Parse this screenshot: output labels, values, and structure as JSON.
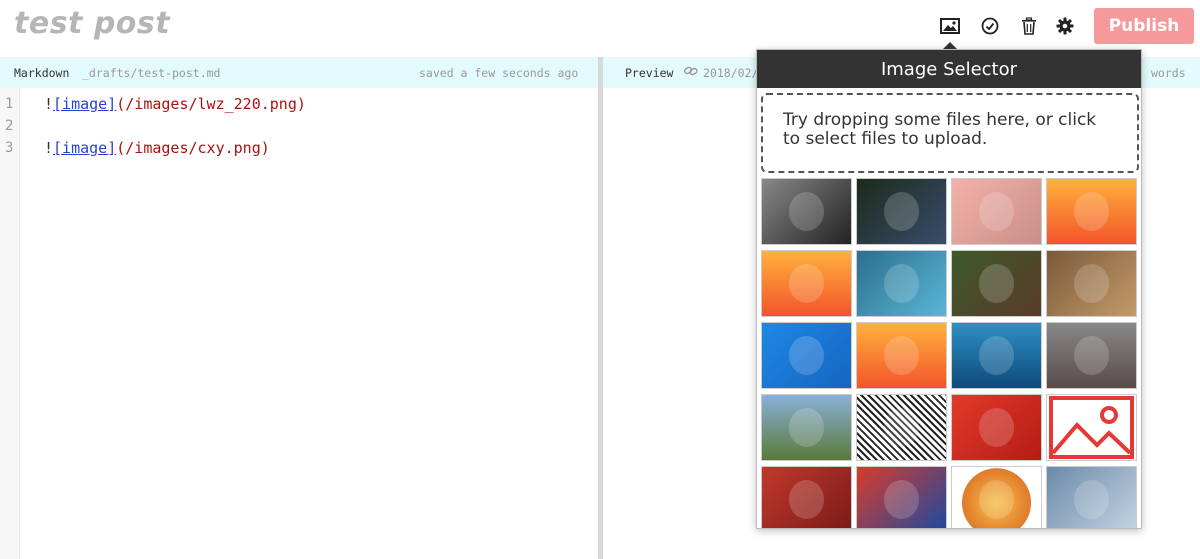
{
  "header": {
    "title": "test post",
    "publish_label": "Publish",
    "icons": [
      "image-icon",
      "check-circle-icon",
      "trash-icon",
      "gear-icon"
    ]
  },
  "editor_bar": {
    "mode": "Markdown",
    "file_path": "_drafts/test-post.md",
    "save_status": "saved a few seconds ago"
  },
  "preview_bar": {
    "mode": "Preview",
    "permalink": "2018/02/",
    "words": "words"
  },
  "editor": {
    "lines": [
      {
        "number": "1",
        "bang": "!",
        "link_text": "[image]",
        "link_url": "(/images/lwz_220.png)"
      },
      {
        "number": "2",
        "bang": "",
        "link_text": "",
        "link_url": ""
      },
      {
        "number": "3",
        "bang": "!",
        "link_text": "[image]",
        "link_url": "(/images/cxy.png)"
      }
    ]
  },
  "image_selector": {
    "title": "Image Selector",
    "dropzone_text": "Try dropping some files here, or click to select files to upload.",
    "thumbnails": [
      {
        "name": "portrait-man",
        "bg": "linear-gradient(135deg,#888,#222)"
      },
      {
        "name": "code-screenshot",
        "bg": "linear-gradient(135deg,#1b2a1b,#3a4d6b)"
      },
      {
        "name": "face-closeup",
        "bg": "linear-gradient(135deg,#f3b2a8,#c98f88)"
      },
      {
        "name": "monkey-cartoon",
        "bg": "linear-gradient(180deg,#ffb13d,#f2542a)"
      },
      {
        "name": "monkey-cartoon",
        "bg": "linear-gradient(180deg,#ffb13d,#f2542a)"
      },
      {
        "name": "blue-monkey",
        "bg": "linear-gradient(135deg,#2c6f8f,#5ab6d6)"
      },
      {
        "name": "rabbit",
        "bg": "linear-gradient(135deg,#3d5a2a,#5a3a2a)"
      },
      {
        "name": "screaming-face",
        "bg": "linear-gradient(135deg,#7a5a3a,#c49a6a)"
      },
      {
        "name": "icheck-logo",
        "bg": "linear-gradient(135deg,#1e88e5,#1565c0)"
      },
      {
        "name": "monkey-cartoon",
        "bg": "linear-gradient(180deg,#ffb13d,#f2542a)"
      },
      {
        "name": "sea-ship",
        "bg": "linear-gradient(180deg,#2f8fc4,#0d4a7a)"
      },
      {
        "name": "race-car",
        "bg": "linear-gradient(180deg,#888,#5a4a4a)"
      },
      {
        "name": "horse-racing",
        "bg": "linear-gradient(180deg,#8ab0d8,#5a7a3a)"
      },
      {
        "name": "qr-code",
        "bg": "repeating-linear-gradient(45deg,#fff 0 3px,#222 3px 5px)"
      },
      {
        "name": "red-papercut",
        "bg": "linear-gradient(135deg,#e23a2a,#b31c15)"
      },
      {
        "name": "placeholder-image",
        "bg": "#ffffff"
      },
      {
        "name": "kpmg-poster",
        "bg": "linear-gradient(135deg,#c0392b,#7a1a1a)"
      },
      {
        "name": "stralive-poster",
        "bg": "linear-gradient(135deg,#d93b2a,#1a4aa0)"
      },
      {
        "name": "orange-ornament",
        "bg": "radial-gradient(circle at 50% 55%,#f7c04a,#e07a2a 60%,#fff 61%)"
      },
      {
        "name": "tornado-art",
        "bg": "linear-gradient(135deg,#6a8aa8,#c4d4e4)"
      }
    ]
  }
}
